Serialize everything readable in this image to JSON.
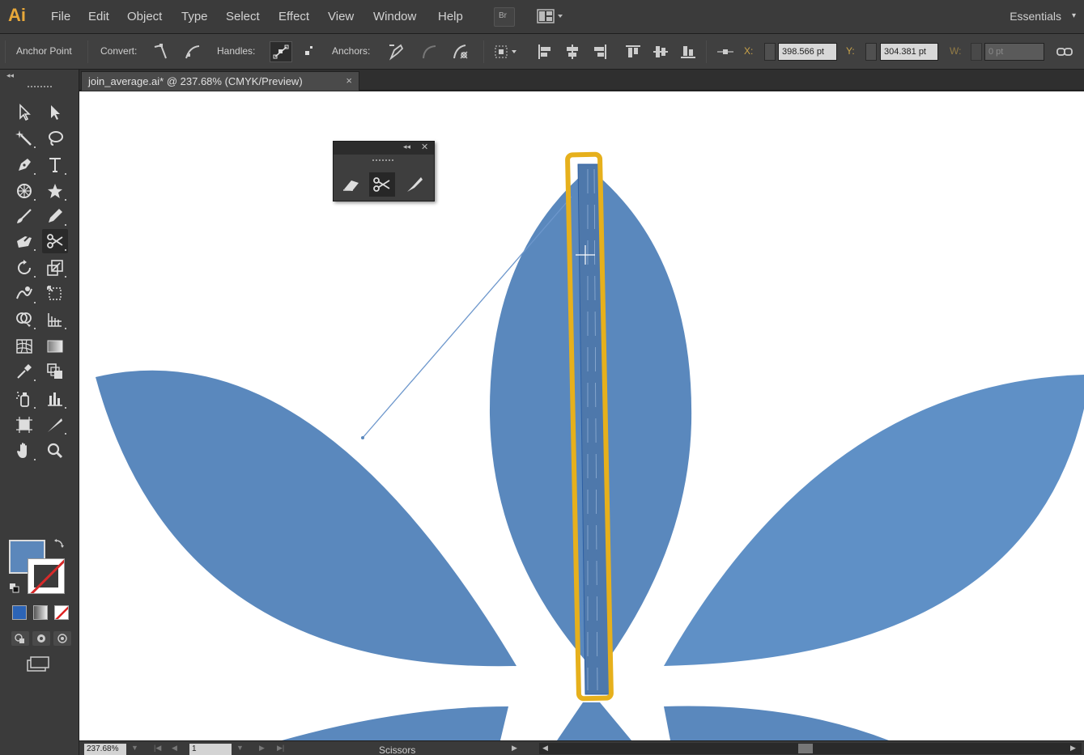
{
  "app": {
    "logo": "Ai"
  },
  "menu": [
    "File",
    "Edit",
    "Object",
    "Type",
    "Select",
    "Effect",
    "View",
    "Window",
    "Help"
  ],
  "menubar": {
    "bridge_label": "Br",
    "workspace": "Essentials",
    "workspace_arrow": "▾"
  },
  "control": {
    "tool_label": "Anchor Point",
    "convert_label": "Convert:",
    "handles_label": "Handles:",
    "anchors_label": "Anchors:",
    "x_label": "X:",
    "x_value": "398.566 pt",
    "y_label": "Y:",
    "y_value": "304.381 pt",
    "w_label": "W:",
    "w_value": "0 pt"
  },
  "tools": {
    "items": [
      "selection-tool",
      "direct-selection-tool",
      "magic-wand-tool",
      "lasso-tool",
      "pen-tool",
      "type-tool",
      "ellipse-tool",
      "star-tool",
      "paintbrush-tool",
      "pencil-tool",
      "blob-brush-tool",
      "scissors-tool",
      "rotate-tool",
      "scale-tool",
      "warp-tool",
      "free-transform-tool",
      "shape-builder-tool",
      "perspective-grid-tool",
      "mesh-tool",
      "gradient-tool",
      "eyedropper-tool",
      "blend-tool",
      "symbol-sprayer-tool",
      "column-graph-tool",
      "artboard-tool",
      "slice-tool",
      "hand-tool",
      "zoom-tool"
    ],
    "active": "scissors-tool"
  },
  "colors": {
    "fill": "#5b87bb",
    "accent": "#e6b01c",
    "petal": "#5a88bd"
  },
  "document": {
    "tab_title": "join_average.ai* @ 237.68% (CMYK/Preview)",
    "close": "×"
  },
  "floating_panel": {
    "collapse": "◂◂",
    "close": "✕",
    "tools": [
      "eraser-tool",
      "scissors-tool",
      "knife-tool"
    ],
    "active": "scissors-tool"
  },
  "status": {
    "zoom": "237.68%",
    "page": "1",
    "current_tool": "Scissors"
  }
}
